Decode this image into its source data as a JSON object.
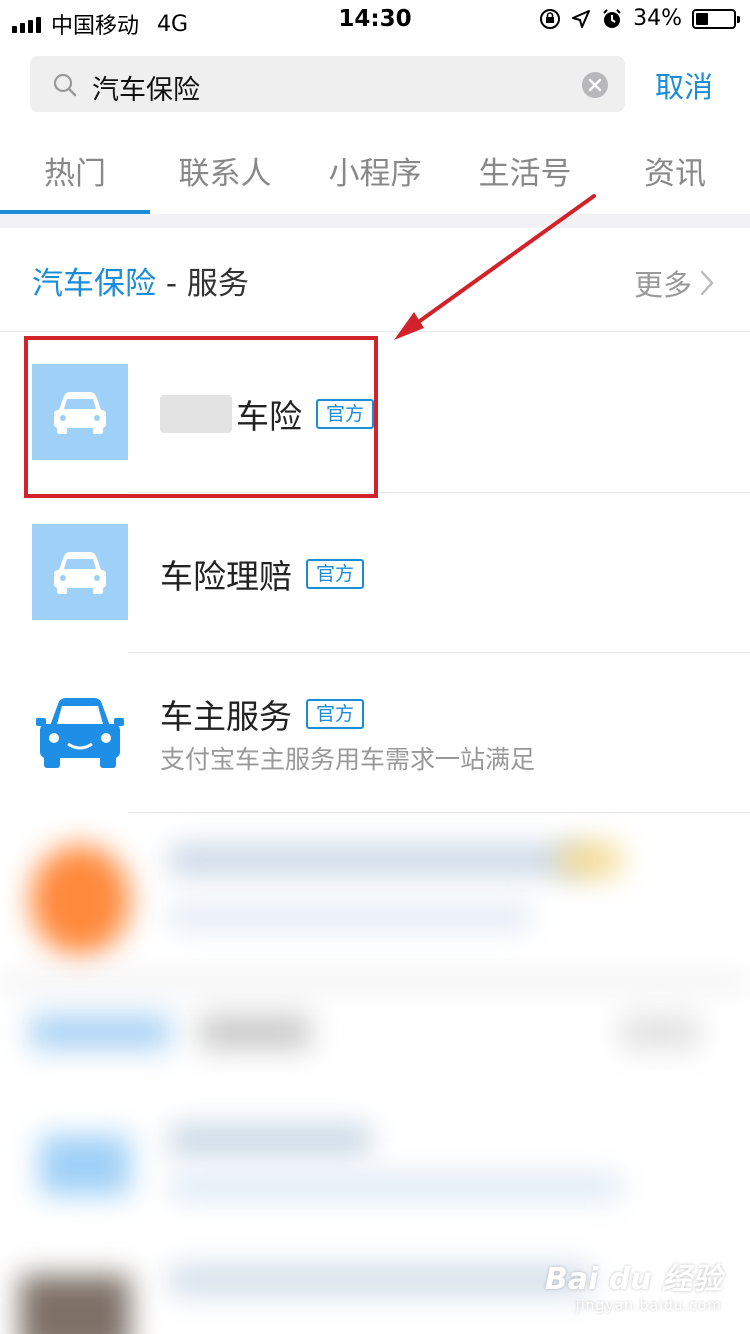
{
  "status_bar": {
    "carrier": "中国移动",
    "network": "4G",
    "time": "14:30",
    "battery": "34%",
    "battery_level": 0.34
  },
  "search": {
    "query": "汽车保险",
    "cancel_label": "取消"
  },
  "tabs": [
    {
      "label": "热门",
      "active": true
    },
    {
      "label": "联系人",
      "active": false
    },
    {
      "label": "小程序",
      "active": false
    },
    {
      "label": "生活号",
      "active": false
    },
    {
      "label": "资讯",
      "active": false
    }
  ],
  "section": {
    "keyword": "汽车保险",
    "suffix": " - 服务",
    "more_label": "更多"
  },
  "results": [
    {
      "title": "车险",
      "badge": "官方",
      "subtitle": "",
      "icon": "car-icon"
    },
    {
      "title": "车险理赔",
      "badge": "官方",
      "subtitle": "",
      "icon": "car-icon"
    },
    {
      "title": "车主服务",
      "badge": "官方",
      "subtitle": "支付宝车主服务用车需求一站满足",
      "icon": "car-icon"
    }
  ],
  "watermark": {
    "main": "Bai du 经验",
    "sub": "jingyan.baidu.com"
  },
  "colors": {
    "accent": "#1a8cd8",
    "icon_light_bg": "#9fd0f7",
    "car_blue": "#1f8ee6",
    "highlight": "#d2232a"
  }
}
